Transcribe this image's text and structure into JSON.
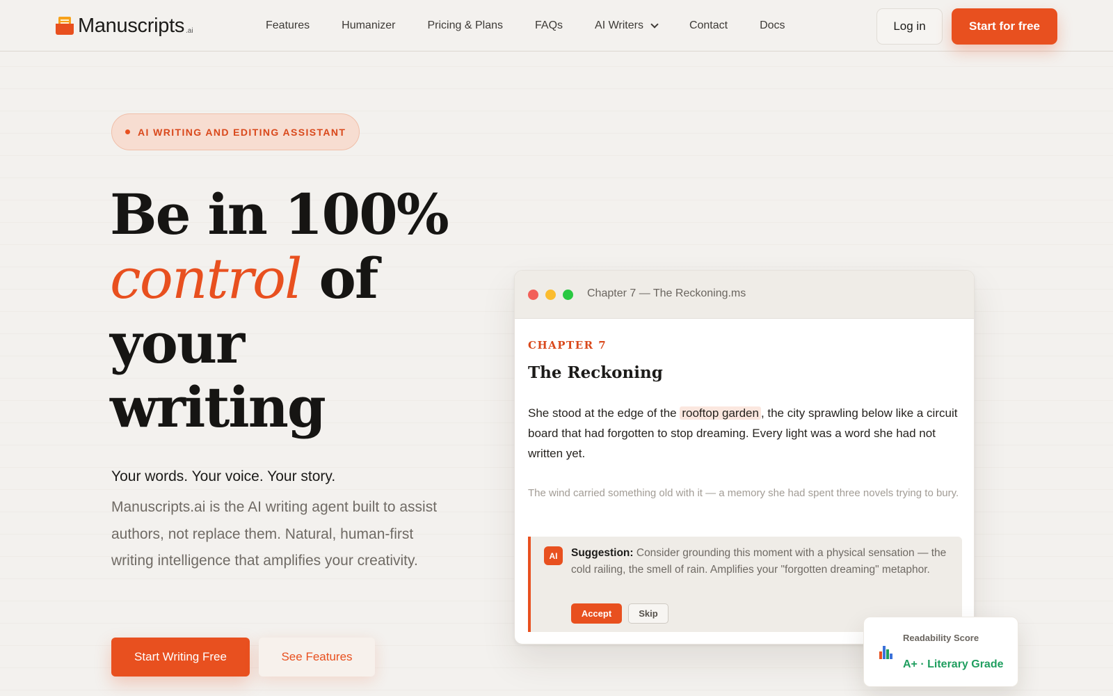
{
  "brand": {
    "name": "Manuscripts",
    "suffix": ".ai"
  },
  "nav": {
    "links": [
      "Features",
      "Humanizer",
      "Pricing & Plans",
      "FAQs",
      "AI Writers",
      "Contact",
      "Docs"
    ],
    "login_label": "Log in",
    "start_label": "Start for free"
  },
  "hero": {
    "badge": "AI WRITING AND EDITING ASSISTANT",
    "headline": {
      "line1": "Be in 100%",
      "accent": "control",
      "line2_rest": " of",
      "line3": "your",
      "line4": "writing"
    },
    "sub_lead": "Your words. Your voice. Your story.",
    "sub_body": "Manuscripts.ai is the AI writing agent built to assist authors, not replace them. Natural, human-first writing intelligence that amplifies your creativity.",
    "cta_primary": "Start Writing Free",
    "cta_secondary": "See Features"
  },
  "editor": {
    "window_title": "Chapter 7 — The Reckoning.ms",
    "chapter_label": "CHAPTER 7",
    "chapter_title": "The Reckoning",
    "para1_before": "She stood at the edge of the ",
    "para1_highlight": "rooftop garden",
    "para1_after": ", the city sprawling below like a circuit board that had forgotten to stop dreaming. Every light was a word she had not written yet.",
    "para2": "The wind carried something old with it — a memory she had spent three novels trying to bury.",
    "suggestion": {
      "ai_label": "AI",
      "lead": "Suggestion:",
      "text": " Consider grounding this moment with a physical sensation — the cold railing, the smell of rain. Amplifies your \"forgotten dreaming\" metaphor.",
      "accept_label": "Accept",
      "skip_label": "Skip"
    }
  },
  "readability": {
    "label": "Readability Score",
    "grade": "A+ · Literary Grade",
    "icon": "bar-chart-icon"
  },
  "colors": {
    "accent": "#e8501f",
    "background": "#f3f1ee",
    "success": "#1f9e5f"
  }
}
